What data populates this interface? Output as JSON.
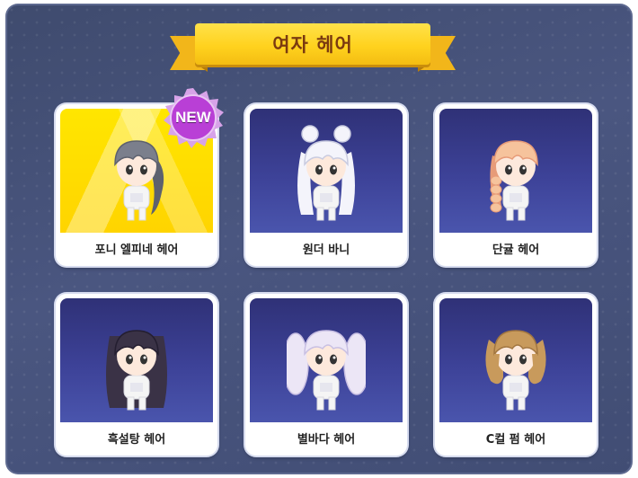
{
  "banner": {
    "title": "여자 헤어"
  },
  "badge": {
    "label": "NEW"
  },
  "cards": [
    {
      "label": "포니 엘피네 헤어",
      "hair_color": "#7b7f8c",
      "hair_shade": "#5d616e",
      "style": "ponytail",
      "is_new": true
    },
    {
      "label": "원더 바니",
      "hair_color": "#f4f4fb",
      "hair_shade": "#c9cbe0",
      "style": "buns"
    },
    {
      "label": "단귤 헤어",
      "hair_color": "#f6c39c",
      "hair_shade": "#e79b78",
      "style": "side-braid"
    },
    {
      "label": "흑설탕 헤어",
      "hair_color": "#3a3246",
      "hair_shade": "#241e30",
      "style": "long-straight"
    },
    {
      "label": "별바다 헤어",
      "hair_color": "#ece6f6",
      "hair_shade": "#c9c0e3",
      "style": "twin-tails"
    },
    {
      "label": "C컬 펌 헤어",
      "hair_color": "#c89a5c",
      "hair_shade": "#a27641",
      "style": "curl"
    }
  ],
  "colors": {
    "panel_bg": "#46527a",
    "card_art_bg": "#3a3f92",
    "featured_bg": "#ffe000",
    "banner_yellow": "#ffd21e",
    "badge_purple": "#b93fd6"
  }
}
